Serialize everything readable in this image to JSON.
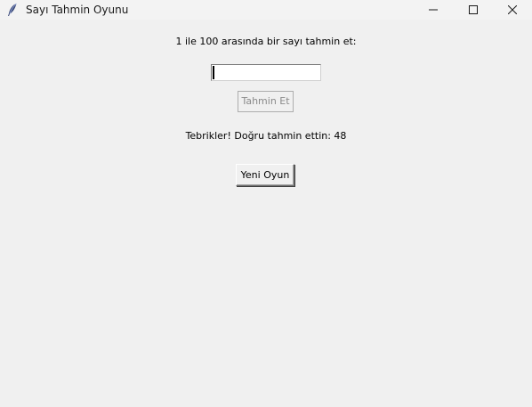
{
  "window": {
    "title": "Sayı Tahmin Oyunu",
    "icon": "feather-icon",
    "controls": {
      "minimize": "minimize-icon",
      "maximize": "maximize-icon",
      "close": "close-icon"
    }
  },
  "main": {
    "prompt": "1 ile 100 arasında bir sayı tahmin et:",
    "guess_input": {
      "value": ""
    },
    "guess_button_label": "Tahmin Et",
    "guess_button_state": "disabled",
    "result_text": "Tebrikler! Doğru tahmin ettin: 48",
    "new_game_button_label": "Yeni Oyun"
  }
}
